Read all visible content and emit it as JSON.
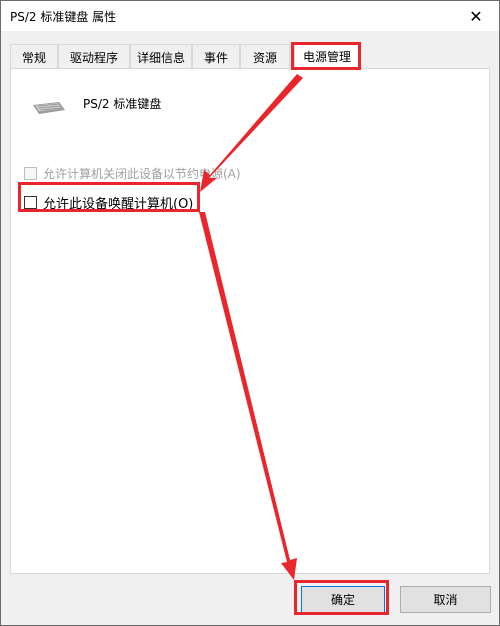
{
  "window": {
    "title": "PS/2 标准键盘 属性",
    "close_glyph": "✕"
  },
  "tabs": [
    {
      "label": "常规",
      "active": false
    },
    {
      "label": "驱动程序",
      "active": false
    },
    {
      "label": "详细信息",
      "active": false
    },
    {
      "label": "事件",
      "active": false
    },
    {
      "label": "资源",
      "active": false
    },
    {
      "label": "电源管理",
      "active": true
    }
  ],
  "device": {
    "name": "PS/2 标准键盘",
    "icon": "keyboard-icon"
  },
  "power": {
    "allow_turn_off_label": "允许计算机关闭此设备以节约电源(A)",
    "allow_turn_off_checked": false,
    "allow_turn_off_enabled": false,
    "allow_wake_label": "允许此设备唤醒计算机(O)",
    "allow_wake_checked": false,
    "allow_wake_enabled": true
  },
  "buttons": {
    "ok_label": "确定",
    "cancel_label": "取消"
  },
  "annotation": {
    "highlight_color": "#e8262b"
  }
}
